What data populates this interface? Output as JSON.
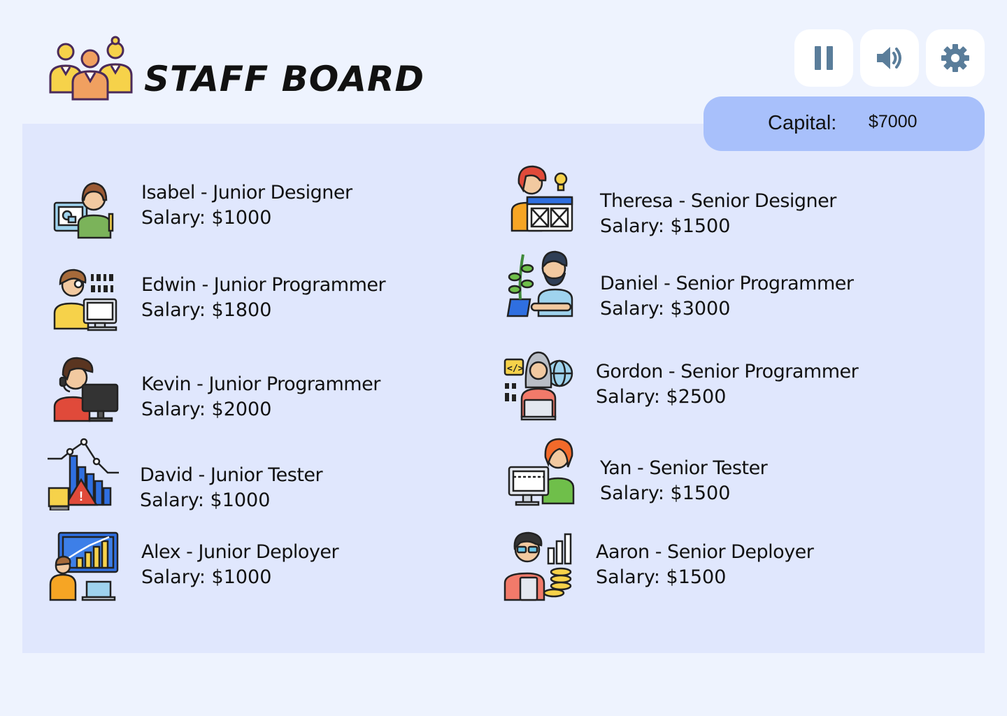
{
  "header": {
    "title": "STAFF BOARD",
    "logo_icon": "staff-group-icon"
  },
  "controls": {
    "pause_icon": "pause-icon",
    "sound_icon": "speaker-icon",
    "settings_icon": "gear-icon"
  },
  "capital": {
    "label": "Capital:",
    "value": "$7000"
  },
  "staff_left": [
    {
      "name": "Isabel - Junior Designer",
      "salary": "Salary: $1000",
      "icon": "designer-icon"
    },
    {
      "name": "Edwin - Junior Programmer",
      "salary": "Salary: $1800",
      "icon": "programmer-icon"
    },
    {
      "name": "Kevin - Junior Programmer",
      "salary": "Salary: $2000",
      "icon": "programmer-headset-icon"
    },
    {
      "name": "David - Junior Tester",
      "salary": "Salary: $1000",
      "icon": "tester-chart-icon"
    },
    {
      "name": "Alex - Junior Deployer",
      "salary": "Salary: $1000",
      "icon": "deployer-icon"
    }
  ],
  "staff_right": [
    {
      "name": "Theresa - Senior Designer",
      "salary": "Salary: $1500",
      "icon": "designer-icon"
    },
    {
      "name": "Daniel - Senior Programmer",
      "salary": "Salary: $3000",
      "icon": "programmer-plant-icon"
    },
    {
      "name": "Gordon - Senior Programmer",
      "salary": "Salary: $2500",
      "icon": "hacker-icon"
    },
    {
      "name": "Yan - Senior Tester",
      "salary": "Salary: $1500",
      "icon": "tester-computer-icon"
    },
    {
      "name": "Aaron - Senior Deployer",
      "salary": "Salary: $1500",
      "icon": "deployer-coins-icon"
    }
  ],
  "colors": {
    "background": "#eef3fe",
    "board": "#e0e7fd",
    "capital_panel": "#a8c0fb",
    "control_icon": "#5a7d9a"
  }
}
